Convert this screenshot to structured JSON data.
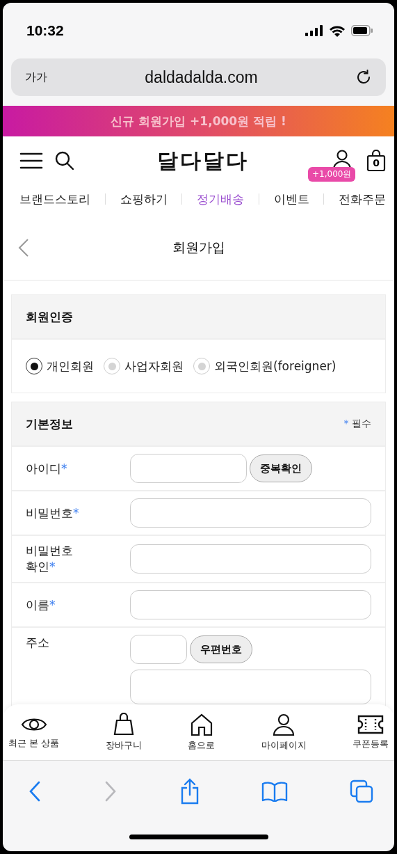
{
  "status_bar": {
    "time": "10:32"
  },
  "browser": {
    "font_size_button": "가가",
    "url": "daldadalda.com"
  },
  "banner": {
    "text": "신규 회원가입 +1,000원 적립 !"
  },
  "header": {
    "logo": "달다달다",
    "reward_badge": "+1,000원",
    "cart_count": "0"
  },
  "nav": [
    {
      "label": "브랜드스토리",
      "selected": false
    },
    {
      "label": "쇼핑하기",
      "selected": false
    },
    {
      "label": "정기배송",
      "selected": true
    },
    {
      "label": "이벤트",
      "selected": false
    },
    {
      "label": "전화주문",
      "selected": false
    }
  ],
  "page_title": "회원가입",
  "verification": {
    "title": "회원인증",
    "options": [
      {
        "label": "개인회원",
        "selected": true
      },
      {
        "label": "사업자회원",
        "selected": false
      },
      {
        "label": "외국인회원(foreigner)",
        "selected": false
      }
    ]
  },
  "basic_info": {
    "title": "기본정보",
    "required_note": {
      "mark": "*",
      "text": "필수"
    },
    "fields": [
      {
        "kind": "with_button",
        "label": "아이디",
        "required_mark": "*",
        "button": "중복확인"
      },
      {
        "kind": "plain",
        "label": "비밀번호",
        "required_mark": "*"
      },
      {
        "kind": "plain",
        "label": "비밀번호 확인",
        "required_mark": "*"
      },
      {
        "kind": "plain",
        "label": "이름",
        "required_mark": "*"
      },
      {
        "kind": "address",
        "label": "주소",
        "button": "우편번호"
      }
    ]
  },
  "bottom_nav": [
    {
      "label": "최근 본 상품"
    },
    {
      "label": "장바구니"
    },
    {
      "label": "홈으로"
    },
    {
      "label": "마이페이지"
    },
    {
      "label": "쿠폰등록"
    }
  ],
  "toolbar": {
    "forward_disabled": true
  }
}
